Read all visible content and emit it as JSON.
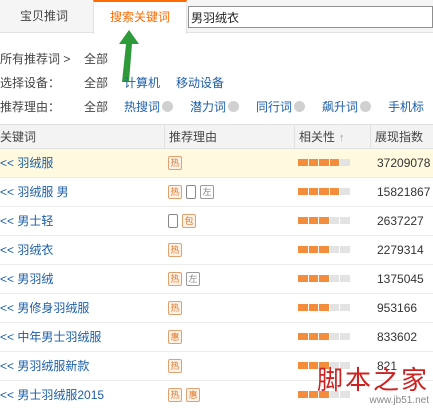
{
  "tabs": {
    "recommend_label": "宝贝推词",
    "search_label": "搜索关键词"
  },
  "search": {
    "value": "男羽绒衣"
  },
  "filters": {
    "path": {
      "label": "所有推荐词 >",
      "value": "全部"
    },
    "device": {
      "label": "选择设备：",
      "options": [
        "全部",
        "计算机",
        "移动设备"
      ]
    },
    "reason": {
      "label": "推荐理由：",
      "options": [
        "全部",
        "热搜词",
        "潜力词",
        "同行词",
        "飙升词",
        "手机标"
      ]
    }
  },
  "table": {
    "headers": {
      "keyword": "关键词",
      "reason": "推荐理由",
      "relevance": "相关性",
      "impressions": "展现指数"
    },
    "rows": [
      {
        "keyword": "<< 羽绒服",
        "badges": [
          "热"
        ],
        "relevance": 4,
        "impressions": "37209078",
        "highlight": true
      },
      {
        "keyword": "<< 羽绒服 男",
        "badges": [
          "热",
          "phone",
          "左"
        ],
        "relevance": 4,
        "impressions": "15821867"
      },
      {
        "keyword": "<< 男士轻",
        "badges": [
          "phone",
          "包"
        ],
        "relevance": 3,
        "impressions": "2637227"
      },
      {
        "keyword": "<< 羽绒衣",
        "badges": [
          "热"
        ],
        "relevance": 3,
        "impressions": "2279314"
      },
      {
        "keyword": "<< 男羽绒",
        "badges": [
          "热",
          "左"
        ],
        "relevance": 3,
        "impressions": "1375045"
      },
      {
        "keyword": "<< 男修身羽绒服",
        "badges": [
          "热"
        ],
        "relevance": 3,
        "impressions": "953166"
      },
      {
        "keyword": "<< 中年男士羽绒服",
        "badges": [
          "惠"
        ],
        "relevance": 3,
        "impressions": "833602"
      },
      {
        "keyword": "<< 男羽绒服新款",
        "badges": [
          "热"
        ],
        "relevance": 3,
        "impressions": "821"
      },
      {
        "keyword": "<< 男士羽绒服2015",
        "badges": [
          "热",
          "惠"
        ],
        "relevance": 3,
        "impressions": ""
      }
    ]
  },
  "watermark": {
    "title": "脚本之家",
    "url": "www.jb51.net"
  },
  "colors": {
    "accent": "#ff6a00",
    "link": "#1c5fa8",
    "relevance_on": "#f38d3c",
    "arrow": "#2e9a3a"
  }
}
